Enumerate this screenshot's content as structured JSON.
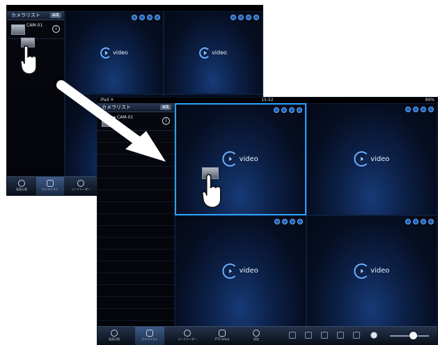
{
  "back": {
    "sidebar_title": "カメラリスト",
    "edit_label": "編集",
    "camera": {
      "name": "CAM-01"
    },
    "tabs": [
      {
        "label": "画面分割"
      },
      {
        "label": "カメラリスト"
      },
      {
        "label": "コードリーダー"
      }
    ]
  },
  "front": {
    "status": {
      "left": "iPad ✈",
      "center": "15:52",
      "right": "89%"
    },
    "sidebar_title": "カメラリスト",
    "edit_label": "編集",
    "camera": {
      "name": "CAM-01"
    },
    "logo_text": "video",
    "tabs": [
      {
        "label": "画面分割"
      },
      {
        "label": "カメラリスト"
      },
      {
        "label": "コードリーダー"
      },
      {
        "label": "PTZ Setup"
      },
      {
        "label": "設定"
      }
    ]
  },
  "colors": {
    "accent": "#2da3ff",
    "pane_glow": "#173a77",
    "background": "#05070d"
  }
}
